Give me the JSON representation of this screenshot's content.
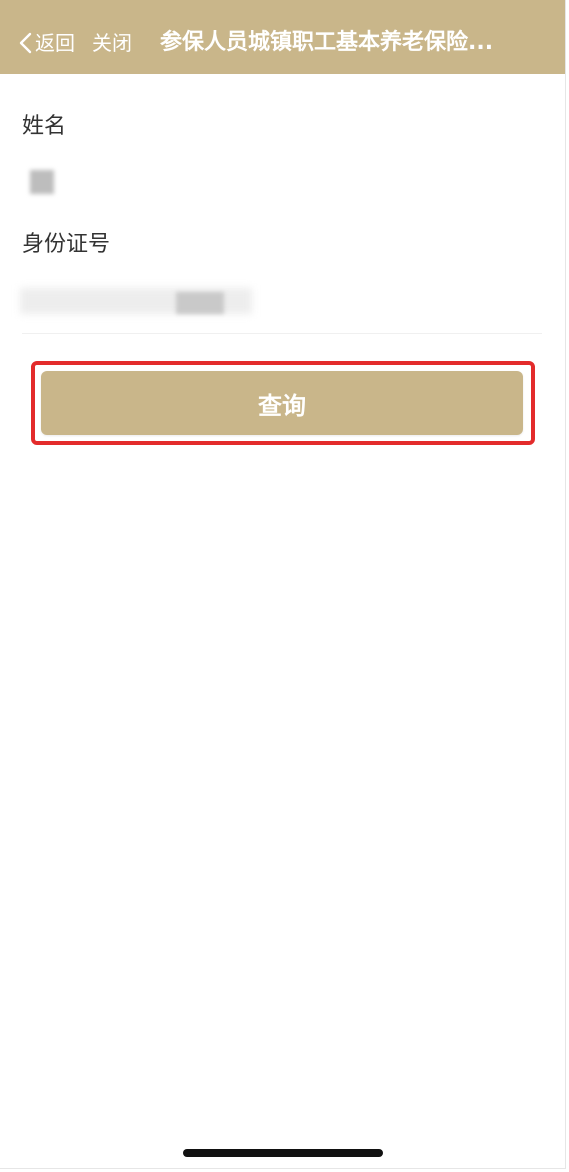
{
  "header": {
    "back_label": "返回",
    "close_label": "关闭",
    "title": "参保人员城镇职工基本养老保险..."
  },
  "form": {
    "name_label": "姓名",
    "id_label": "身份证号"
  },
  "query_button": {
    "label": "查询"
  },
  "colors": {
    "accent": "#c9b68a",
    "highlight": "#e32b2b"
  }
}
